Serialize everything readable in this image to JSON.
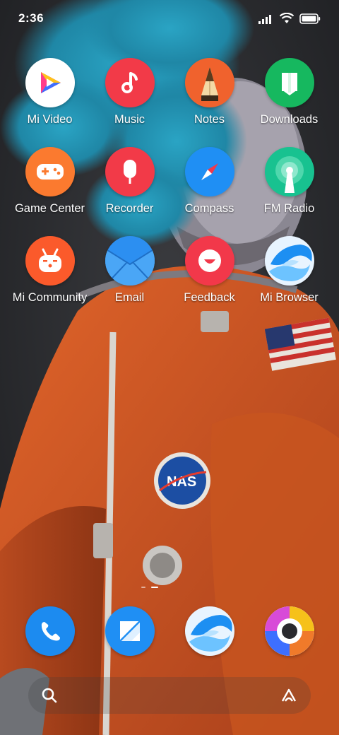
{
  "status_bar": {
    "time": "2:36"
  },
  "apps": [
    {
      "label": "Mi Video",
      "icon": "mi-video-icon",
      "color": "#ffffff"
    },
    {
      "label": "Music",
      "icon": "music-icon",
      "color": "#f23a48"
    },
    {
      "label": "Notes",
      "icon": "notes-icon",
      "color": "#f0622d"
    },
    {
      "label": "Downloads",
      "icon": "downloads-icon",
      "color": "#16b85f"
    },
    {
      "label": "Game Center",
      "icon": "game-center-icon",
      "color": "#fb7a2f"
    },
    {
      "label": "Recorder",
      "icon": "recorder-icon",
      "color": "#f23a48"
    },
    {
      "label": "Compass",
      "icon": "compass-icon",
      "color": "#1f8ff4"
    },
    {
      "label": "FM Radio",
      "icon": "fm-radio-icon",
      "color": "#18c290"
    },
    {
      "label": "Mi Community",
      "icon": "mi-community-icon",
      "color": "#fb5a2b"
    },
    {
      "label": "Email",
      "icon": "email-icon",
      "color": "#2c8ff1"
    },
    {
      "label": "Feedback",
      "icon": "feedback-icon",
      "color": "#f2384a"
    },
    {
      "label": "Mi Browser",
      "icon": "mi-browser-icon",
      "color": "#e8f4ff"
    }
  ],
  "dock": [
    {
      "icon": "phone-icon",
      "color": "#1c8bf0"
    },
    {
      "icon": "messages-icon",
      "color": "#1f8ff4"
    },
    {
      "icon": "browser-icon",
      "color": "#e8f4ff"
    },
    {
      "icon": "chrome-icon",
      "color": "#ffffff"
    }
  ]
}
